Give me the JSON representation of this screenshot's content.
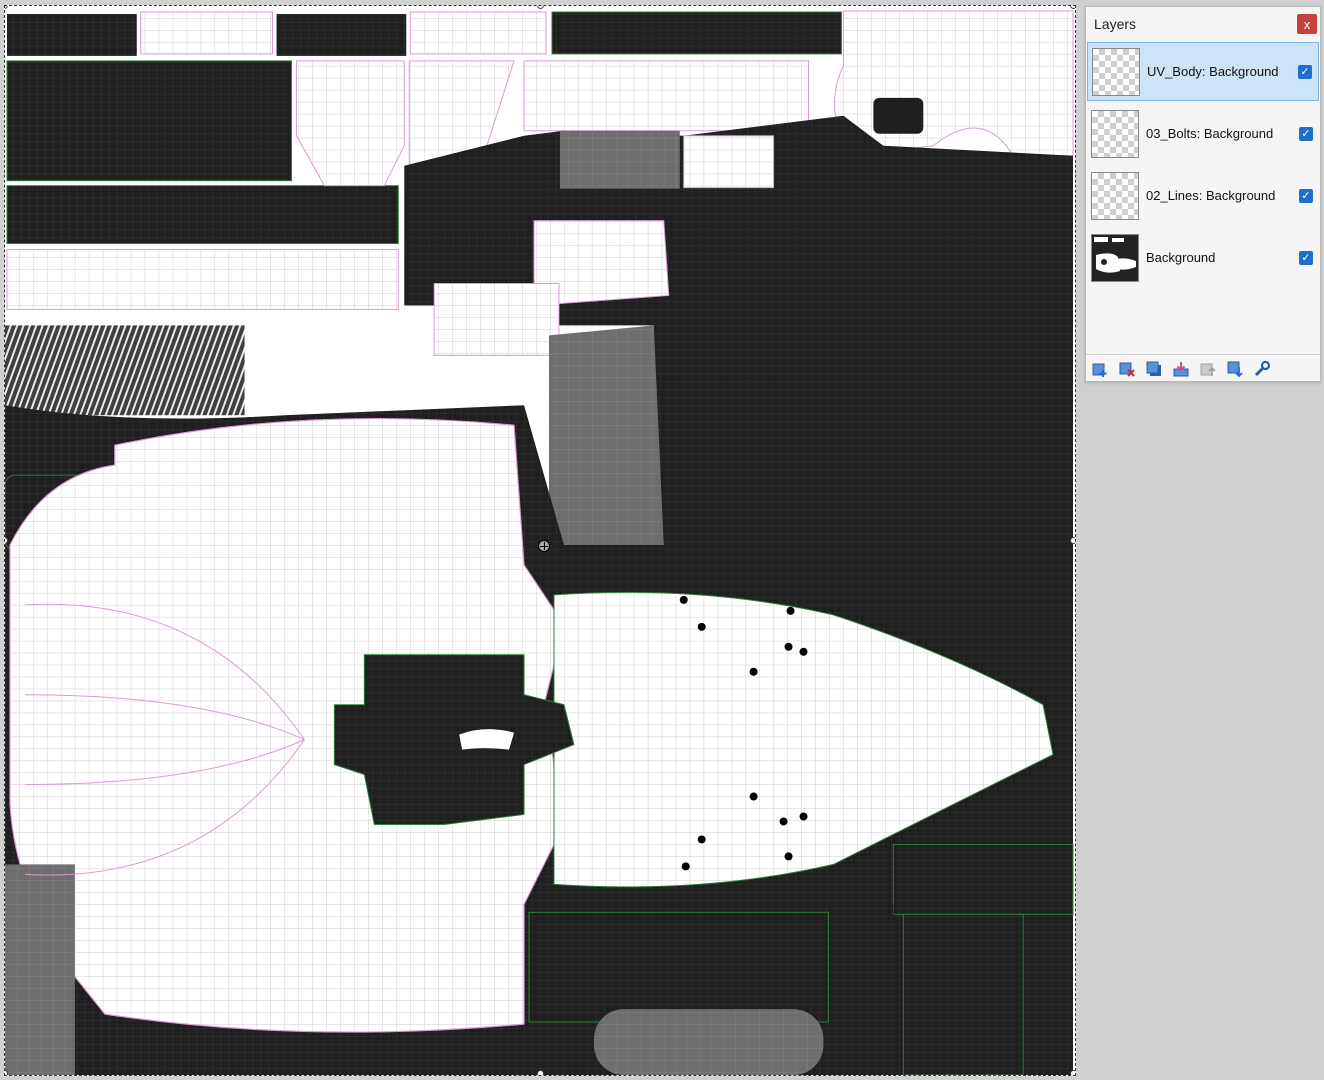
{
  "layers_panel": {
    "title": "Layers",
    "close_label": "x",
    "layers": [
      {
        "name": "UV_Body: Background",
        "visible": true,
        "selected": true
      },
      {
        "name": "03_Bolts: Background",
        "visible": true,
        "selected": false
      },
      {
        "name": "02_Lines: Background",
        "visible": true,
        "selected": false
      },
      {
        "name": "Background",
        "visible": true,
        "selected": false
      }
    ],
    "toolbar": [
      {
        "icon": "add-layer-icon"
      },
      {
        "icon": "delete-layer-icon"
      },
      {
        "icon": "duplicate-layer-icon"
      },
      {
        "icon": "merge-layer-down-icon"
      },
      {
        "icon": "move-layer-up-icon"
      },
      {
        "icon": "move-layer-down-icon"
      },
      {
        "icon": "layer-properties-icon"
      }
    ]
  },
  "colors": {
    "selection": "#cce4f7",
    "checkbox": "#1e6fd0",
    "close": "#c94040",
    "uv_dark": "#1f1f1f",
    "uv_grid_light": "#b9b9b9",
    "uv_outline_green": "#2f7d3a",
    "uv_outline_pink": "#d99bd6"
  }
}
